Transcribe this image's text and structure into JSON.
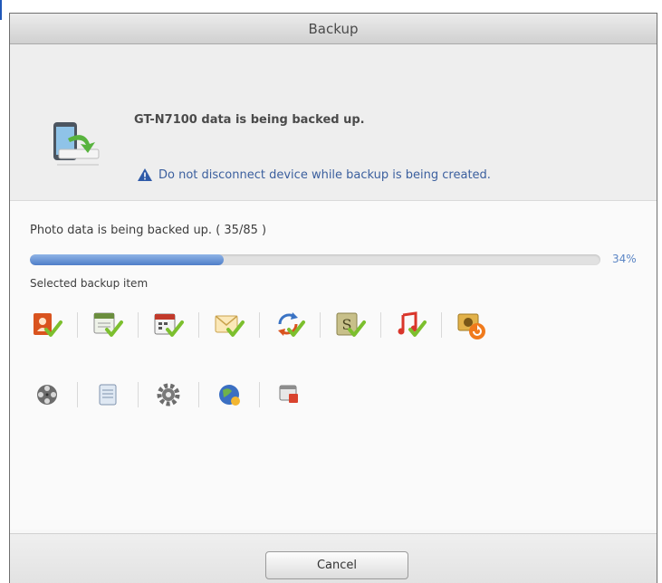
{
  "dialog": {
    "title": "Backup"
  },
  "header": {
    "device_message": "GT-N7100 data is being backed up.",
    "warning_text": "Do not disconnect device while backup is being created.",
    "device_icon": "phone-sync-icon",
    "warning_icon": "warning-triangle-icon"
  },
  "progress": {
    "status_text": "Photo data is being backed up. ( 35/85 )",
    "percent_label": "34%",
    "fraction": 0.34
  },
  "backup_items": {
    "label": "Selected backup item",
    "row1": [
      {
        "icon": "contacts-icon",
        "checked": true
      },
      {
        "icon": "notes-icon",
        "checked": true
      },
      {
        "icon": "calendar-icon",
        "checked": true
      },
      {
        "icon": "messages-icon",
        "checked": true
      },
      {
        "icon": "sync-icon",
        "checked": true
      },
      {
        "icon": "s-planner-icon",
        "checked": true
      },
      {
        "icon": "music-icon",
        "checked": true
      },
      {
        "icon": "photo-in-progress-icon",
        "checked": false
      }
    ],
    "row2": [
      {
        "icon": "video-icon"
      },
      {
        "icon": "document-icon"
      },
      {
        "icon": "settings-icon"
      },
      {
        "icon": "internet-icon"
      },
      {
        "icon": "applications-icon"
      }
    ]
  },
  "footer": {
    "cancel_label": "Cancel"
  },
  "colors": {
    "accent": "#3b5f9e",
    "progress_fill": "#4f7ec8",
    "check": "#7cbf2e",
    "in_progress": "#f07a1c"
  }
}
